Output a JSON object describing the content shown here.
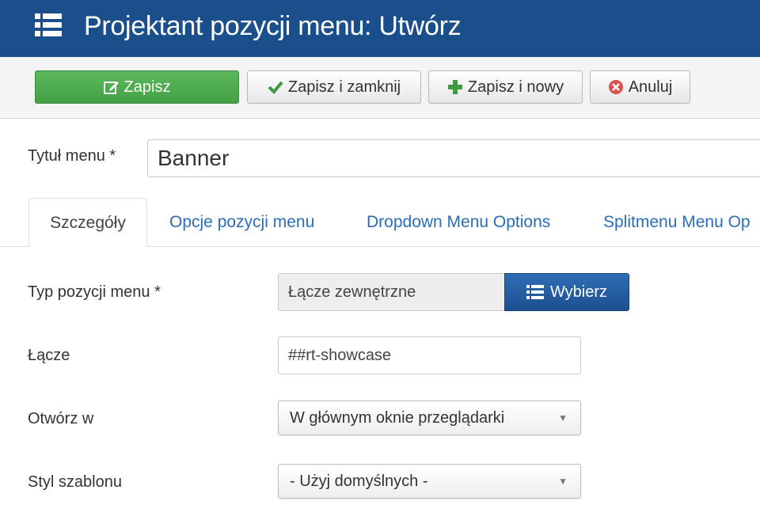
{
  "header": {
    "title": "Projektant pozycji menu: Utwórz",
    "icon": "list-icon"
  },
  "toolbar": {
    "save_label": "Zapisz",
    "save_close_label": "Zapisz i zamknij",
    "save_new_label": "Zapisz i nowy",
    "cancel_label": "Anuluj"
  },
  "form": {
    "title_label": "Tytuł menu *",
    "title_value": "Banner"
  },
  "tabs": [
    {
      "label": "Szczegóły",
      "active": true
    },
    {
      "label": "Opcje pozycji menu",
      "active": false
    },
    {
      "label": "Dropdown Menu Options",
      "active": false
    },
    {
      "label": "Splitmenu Menu Op",
      "active": false
    }
  ],
  "details": {
    "type_label": "Typ pozycji menu *",
    "type_value": "Łącze zewnętrzne",
    "choose_label": "Wybierz",
    "link_label": "Łącze",
    "link_value": "##rt-showcase",
    "open_label": "Otwórz w",
    "open_value": "W głównym oknie przeglądarki",
    "style_label": "Styl szablonu",
    "style_value": "- Użyj domyślnych -"
  },
  "colors": {
    "header_bg": "#1a4f8b",
    "save_green": "#5cb85c",
    "primary_blue": "#2f6db5",
    "link_blue": "#2a6ebb",
    "cancel_red": "#d9534f"
  }
}
